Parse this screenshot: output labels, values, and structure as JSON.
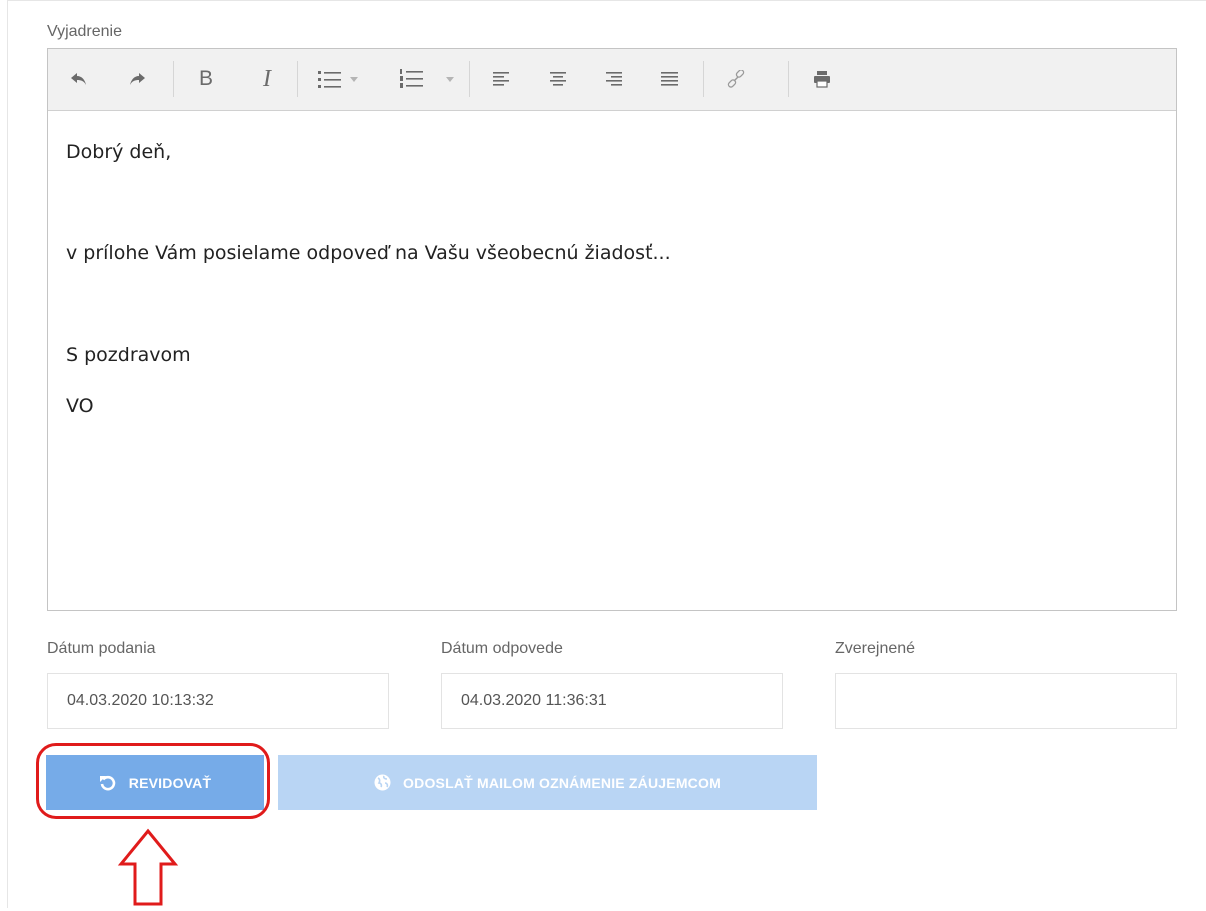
{
  "form": {
    "editor_label": "Vyjadrenie",
    "toolbar": {
      "undo_icon": "undo-icon",
      "redo_icon": "redo-icon",
      "bold": "B",
      "italic": "I",
      "bullet_list_icon": "bullet-list-icon",
      "numbered_list_icon": "numbered-list-icon",
      "align_left_icon": "align-left-icon",
      "align_center_icon": "align-center-icon",
      "align_right_icon": "align-right-icon",
      "align_justify_icon": "align-justify-icon",
      "link_icon": "link-icon",
      "print_icon": "print-icon"
    },
    "editor_content": {
      "line1": "Dobrý deň,",
      "line2": "v prílohe Vám posielame odpoveď na Vašu všeobecnú žiadosť...",
      "line3": "S pozdravom",
      "line4": "VO"
    },
    "fields": {
      "submitted_label": "Dátum podania",
      "submitted_value": "04.03.2020 10:13:32",
      "answered_label": "Dátum odpovede",
      "answered_value": "04.03.2020 11:36:31",
      "published_label": "Zverejnené",
      "published_value": ""
    },
    "buttons": {
      "revise_label": "REVIDOVAŤ",
      "revise_icon": "rotate-ccw-icon",
      "send_mail_label": "ODOSLAŤ MAILOM OZNÁMENIE ZÁUJEMCOM",
      "send_mail_icon": "globe-icon"
    },
    "annotation": {
      "highlight_color": "#e01b1b",
      "arrow_icon": "up-arrow-outline-icon"
    }
  },
  "colors": {
    "primary_button": "#76abe8",
    "disabled_button": "#b9d5f4"
  }
}
